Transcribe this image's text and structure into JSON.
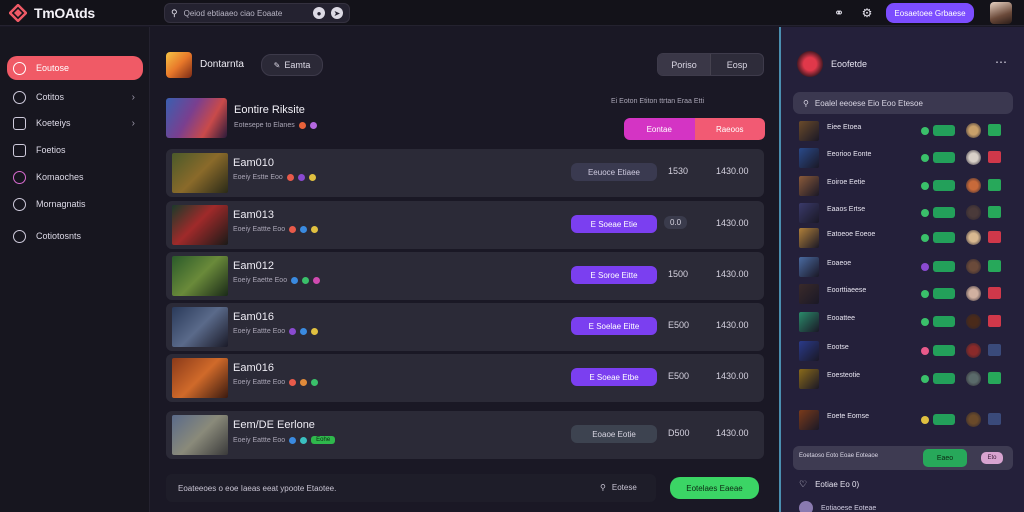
{
  "app": {
    "logo_text": "TmOAtds",
    "brand_color": "#f05a66"
  },
  "topbar": {
    "search_text": "Qeiod ebtiaaeo ciao Eoaate",
    "cta_label": "Eosaetoee Grbaese"
  },
  "sidebar": {
    "items": [
      {
        "label": "Eoutose",
        "icon": "home-icon",
        "active": true
      },
      {
        "label": "Cotitos",
        "icon": "circle-icon",
        "chevron": true
      },
      {
        "label": "Koeteiys",
        "icon": "square-icon",
        "chevron": true
      },
      {
        "label": "Foetios",
        "icon": "folder-icon"
      },
      {
        "label": "Komaoches",
        "icon": "gamepad-icon"
      },
      {
        "label": "Mornagnatis",
        "icon": "settings-icon"
      },
      {
        "label": "Cotiotosnts",
        "icon": "gear-icon"
      }
    ]
  },
  "header": {
    "title": "Dontarnta",
    "pill_label": "Eamta",
    "seg_left": "Poriso",
    "seg_right": "Eosp"
  },
  "featured": {
    "title": "Eontire Riksite",
    "meta": "Eotesepe to Elanes",
    "stats": "Ei Eoton Etiton ttrtan Eraa Etti",
    "btn_left": "Eontae",
    "btn_right": "Raeoos"
  },
  "rows": [
    {
      "name": "Eam010",
      "meta": "Eoeiy Estte Eoo",
      "action": "Eeuoce Etiaee",
      "style": "dark",
      "c1": "1530",
      "c2": "1430.00"
    },
    {
      "name": "Eam013",
      "meta": "Eoeiy Eattte Eoo",
      "action": "E Soeae Etie",
      "style": "purple",
      "c1": "0.0",
      "c1_chip": true,
      "c2": "1430.00"
    },
    {
      "name": "Eam012",
      "meta": "Eoeiy Eaette Eoo",
      "action": "E Soroe Eitte",
      "style": "purple",
      "c1": "1500",
      "c2": "1430.00"
    },
    {
      "name": "Eam016",
      "meta": "Eoeiy Eattte Eoo",
      "action": "E Soelae Eitte",
      "style": "purple",
      "c1": "E500",
      "c2": "1430.00"
    },
    {
      "name": "Eam016",
      "meta": "Eoeiy Eattte Eoo",
      "action": "E Soeae Etbe",
      "style": "purple",
      "c1": "E500",
      "c2": "1430.00"
    },
    {
      "name": "Eem/DE Eerlone",
      "meta": "Eoeiy Eattte Eoo",
      "action": "Eoaoe Eotie",
      "style": "slate",
      "c1": "D500",
      "c2": "1430.00",
      "badge": "Eohe"
    }
  ],
  "chat": {
    "placeholder": "Eoateeoes o eoe Iaeas eeat ypoote Etaotee.",
    "search_label": "Eotese",
    "send_label": "Eotelaes Eaeae"
  },
  "rpanel": {
    "title": "Eoofetde",
    "search_text": "Eoalel eeoese Eio Eoo Etesoe",
    "players": [
      {
        "name": "Eiee Etoea"
      },
      {
        "name": "Eeorioo Eonte"
      },
      {
        "name": "Eoiroe Eetie"
      },
      {
        "name": "Eaaos Ertse"
      },
      {
        "name": "Eatoeoe Eoeoe"
      },
      {
        "name": "Eoaeoe"
      },
      {
        "name": "Eoorttiaeese"
      },
      {
        "name": "Eooattee"
      },
      {
        "name": "Eootse"
      },
      {
        "name": "Eoesteotie"
      },
      {
        "name": "Eoete Eomse"
      }
    ],
    "card_text": "Eoetaoso Eoto Eoae Eoteaoe",
    "card_green": "Eaeo",
    "card_pink": "Eto",
    "footer": "Eotiae Eo 0)",
    "footer2": "Eotiaoese Eoteae"
  }
}
